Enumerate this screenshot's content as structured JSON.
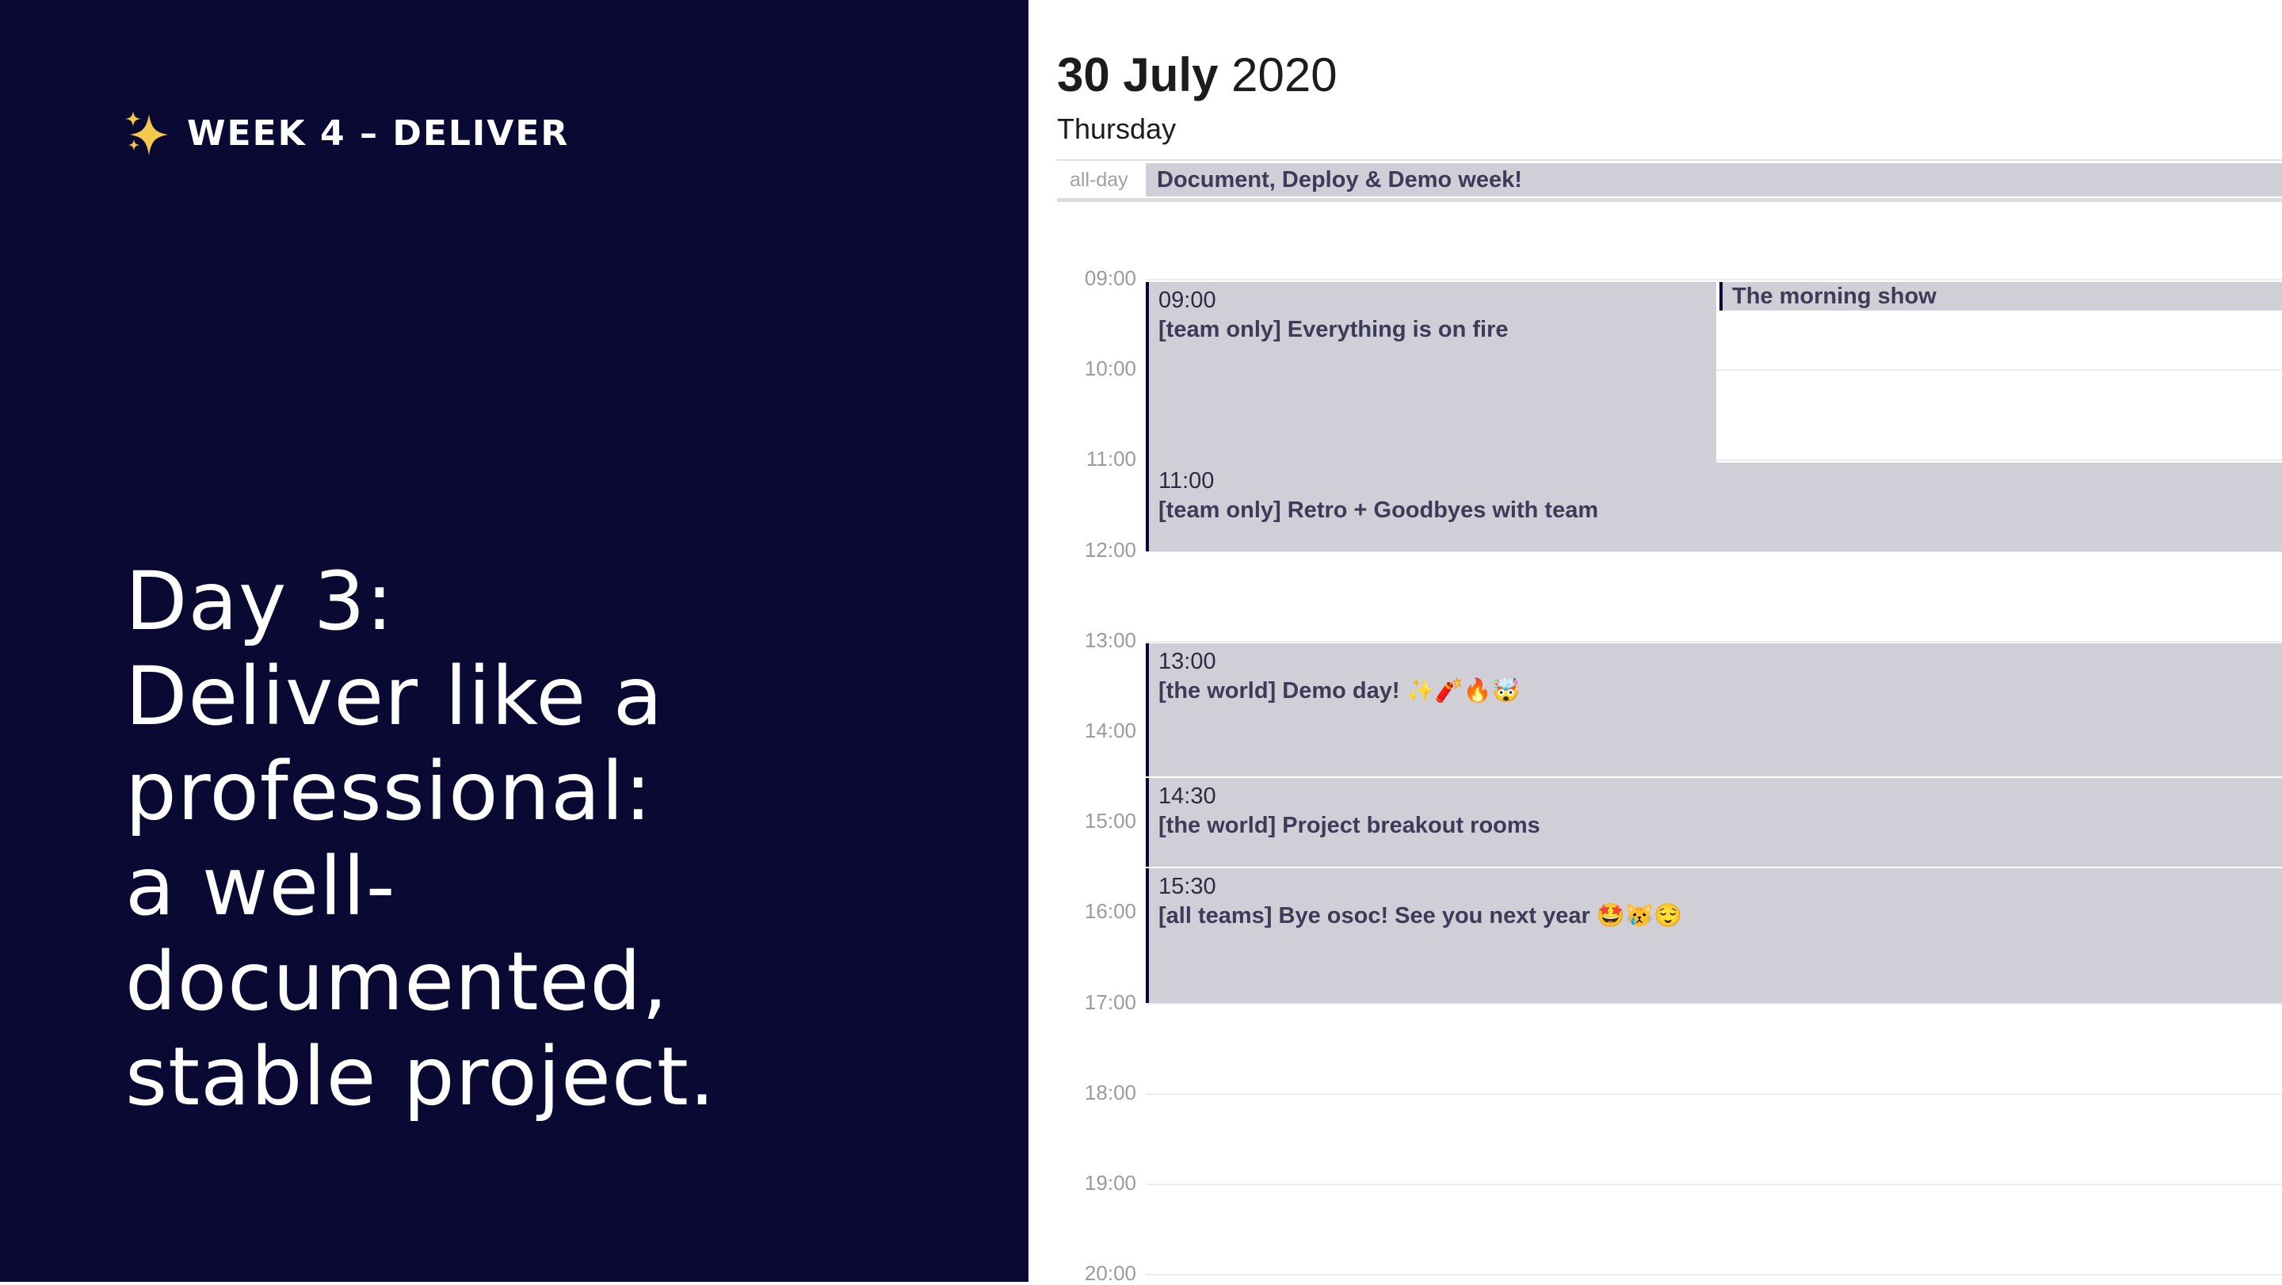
{
  "slide": {
    "week_label": "WEEK 4 – DELIVER",
    "headline_lines": [
      "Day 3:",
      "Deliver like a",
      "professional:",
      "a well-",
      "documented,",
      "stable project."
    ],
    "colors": {
      "panel_bg": "#0a0933",
      "headline": "#ffffff",
      "sparkle": "#f2c94c"
    },
    "icon": "sparkles-icon"
  },
  "calendar": {
    "day_month": "30 July",
    "year": "2020",
    "weekday": "Thursday",
    "all_day_label": "all-day",
    "all_day_event": "Document, Deploy & Demo week!",
    "hours": [
      "09:00",
      "10:00",
      "11:00",
      "12:00",
      "13:00",
      "14:00",
      "15:00",
      "16:00",
      "17:00",
      "18:00",
      "19:00",
      "20:00"
    ],
    "events": [
      {
        "time": "09:00",
        "title": "[team only] Everything is on fire"
      },
      {
        "time": "11:00",
        "title": "[team only] Retro + Goodbyes with team"
      },
      {
        "time": "13:00",
        "title": "[the world] Demo day! ✨🧨🔥🤯"
      },
      {
        "time": "14:30",
        "title": "[the world] Project breakout rooms"
      },
      {
        "time": "15:30",
        "title": "[all teams] Bye osoc! See you next year 🤩😿😌"
      }
    ],
    "side_event": "The morning show",
    "colors": {
      "event_bg": "#d0cfd8",
      "event_bar": "#0a0933",
      "event_text": "#3d3b57"
    }
  }
}
